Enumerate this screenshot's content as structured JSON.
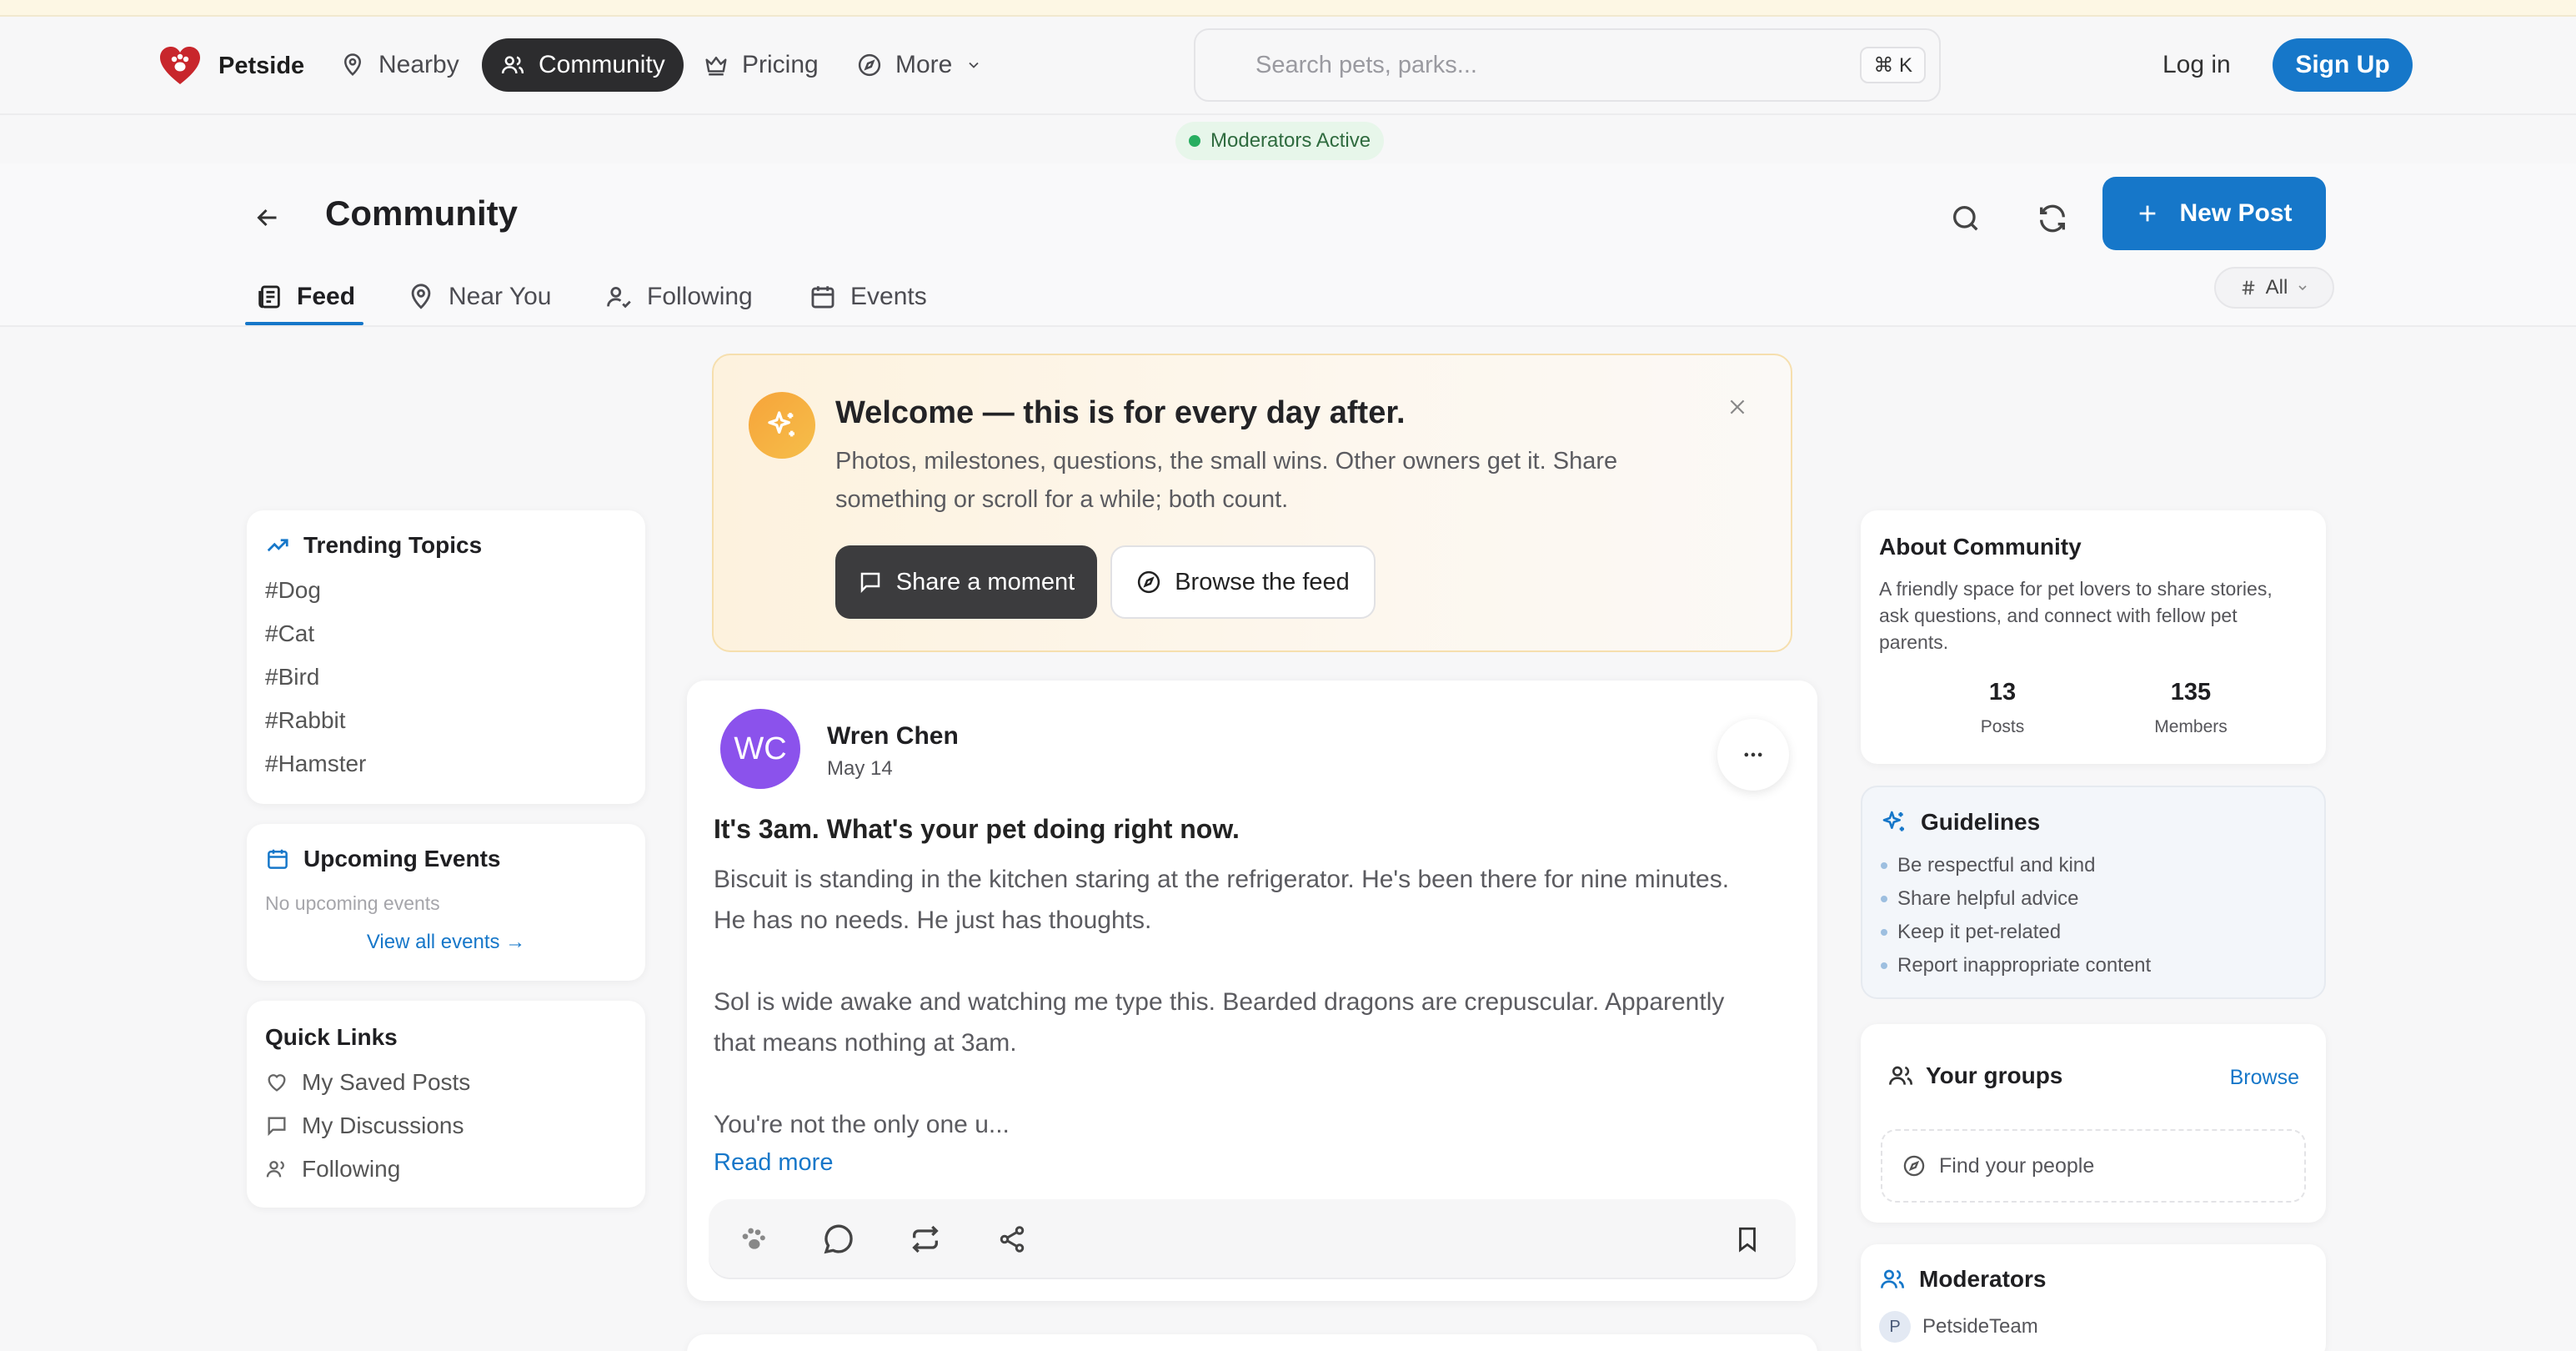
{
  "nav": {
    "logo_text": "Petside",
    "items": [
      {
        "label": "Nearby",
        "icon": "map-pin-icon"
      },
      {
        "label": "Community",
        "icon": "users-icon",
        "active": true
      },
      {
        "label": "Pricing",
        "icon": "crown-icon"
      },
      {
        "label": "More",
        "icon": "compass-icon"
      }
    ],
    "search_placeholder": "Search pets, parks...",
    "search_shortcut": "⌘ K",
    "login_label": "Log in",
    "signup_label": "Sign Up"
  },
  "moderators_badge": "Moderators Active",
  "header": {
    "title": "Community",
    "new_post_label": "New Post",
    "tabs": [
      {
        "label": "Feed",
        "active": true
      },
      {
        "label": "Near You"
      },
      {
        "label": "Following"
      },
      {
        "label": "Events"
      }
    ],
    "filter_label": "All"
  },
  "left": {
    "trending_title": "Trending Topics",
    "trending": [
      "#Dog",
      "#Cat",
      "#Bird",
      "#Rabbit",
      "#Hamster"
    ],
    "events_title": "Upcoming Events",
    "events_empty": "No upcoming events",
    "events_link": "View all events →",
    "quick_title": "Quick Links",
    "quick_links": [
      "My Saved Posts",
      "My Discussions",
      "Following"
    ]
  },
  "welcome": {
    "title": "Welcome — this is for every day after.",
    "text": "Photos, milestones, questions, the small wins. Other owners get it. Share something or scroll for a while; both count.",
    "primary_label": "Share a moment",
    "secondary_label": "Browse the feed"
  },
  "post": {
    "initials": "WC",
    "author": "Wren Chen",
    "date": "May 14",
    "title": "It's 3am. What's your pet doing right now.",
    "paragraphs": [
      "Biscuit is standing in the kitchen staring at the refrigerator. He's been there for nine minutes. He has no needs. He just has thoughts.",
      "Sol is wide awake and watching me type this. Bearded dragons are crepuscular. Apparently that means nothing at 3am.",
      "You're not the only one u..."
    ],
    "read_more": "Read more"
  },
  "right": {
    "about_title": "About Community",
    "about_text": "A friendly space for pet lovers to share stories, ask questions, and connect with fellow pet parents.",
    "posts_count": "13",
    "posts_label": "Posts",
    "members_count": "135",
    "members_label": "Members",
    "guidelines_title": "Guidelines",
    "guidelines": [
      "Be respectful and kind",
      "Share helpful advice",
      "Keep it pet-related",
      "Report inappropriate content"
    ],
    "groups_title": "Your groups",
    "groups_browse": "Browse",
    "groups_find": "Find your people",
    "mods_title": "Moderators",
    "mod_initial": "P",
    "mod_name": "PetsideTeam"
  },
  "colors": {
    "accent": "#1677c9",
    "dark": "#2c2c2e",
    "avatar": "#8b52ec",
    "welcome_icon": "#f7a43a",
    "status_green": "#27ae60"
  }
}
